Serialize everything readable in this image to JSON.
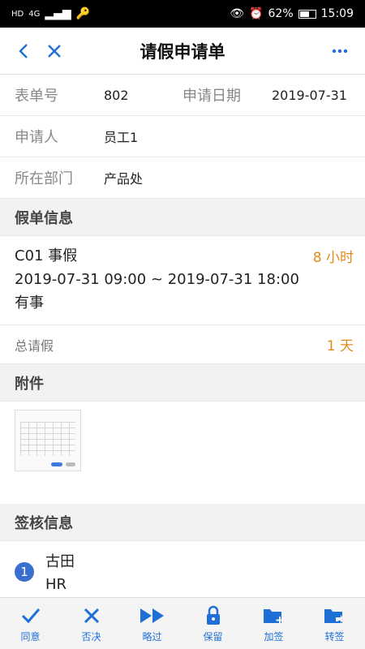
{
  "status_bar": {
    "network": "HD",
    "signal_type": "4G",
    "battery": "62%",
    "battery_fraction": 0.62,
    "time": "15:09"
  },
  "header": {
    "title": "请假申请单"
  },
  "form": {
    "form_no_label": "表单号",
    "form_no": "802",
    "apply_date_label": "申请日期",
    "apply_date": "2019-07-31",
    "applicant_label": "申请人",
    "applicant": "员工1",
    "dept_label": "所在部门",
    "dept": "产品处"
  },
  "leave_section": {
    "title": "假单信息",
    "type": "C01 事假",
    "period": "2019-07-31 09:00 ~ 2019-07-31 18:00",
    "reason": "有事",
    "hours": "8 小时",
    "total_label": "总请假",
    "total_value": "1 天"
  },
  "attachment_section": {
    "title": "附件"
  },
  "approval_section": {
    "title": "签核信息",
    "signers": [
      {
        "index": "1",
        "name": "古田",
        "role": "HR"
      }
    ]
  },
  "toolbar": {
    "agree": "同意",
    "reject": "否决",
    "skip": "略过",
    "keep": "保留",
    "add_sign": "加签",
    "transfer": "转签"
  },
  "colors": {
    "accent": "#1e6fd6",
    "highlight": "#e08a1c"
  }
}
